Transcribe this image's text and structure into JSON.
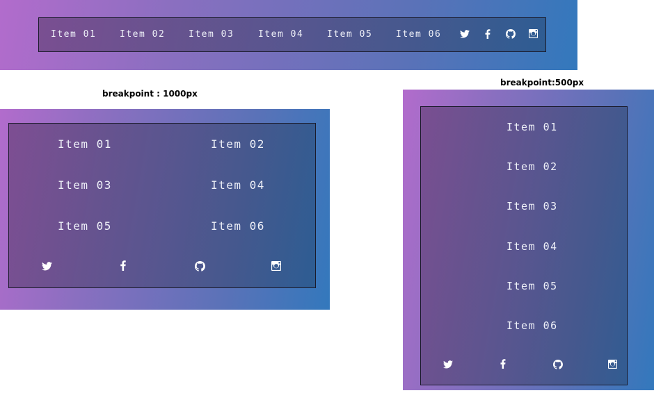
{
  "menu_items": [
    "Item 01",
    "Item 02",
    "Item 03",
    "Item 04",
    "Item 05",
    "Item 06"
  ],
  "icons": [
    "twitter-icon",
    "facebook-icon",
    "github-icon",
    "instagram-icon"
  ],
  "captions": {
    "tablet": "breakpoint : 1000px",
    "mobile": "breakpoint:500px"
  },
  "colors": {
    "gradient_start": "#b26ccc",
    "gradient_end": "#3378bc",
    "text": "#eef0f8",
    "border": "#1a1a2a"
  }
}
